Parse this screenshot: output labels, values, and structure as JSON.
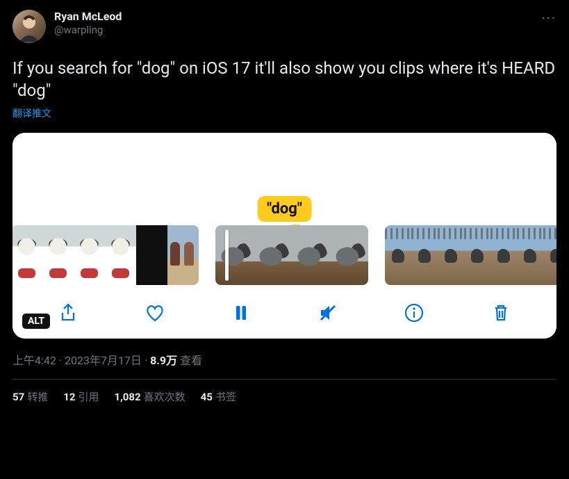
{
  "author": {
    "display_name": "Ryan McLeod",
    "handle": "@warpling"
  },
  "tweet_text": "If you search for \"dog\" on iOS 17 it'll also show you clips where it's HEARD \"dog\"",
  "translate_label": "翻译推文",
  "image": {
    "search_bubble": "\"dog\"",
    "alt_badge": "ALT",
    "controls": {
      "share": "share-icon",
      "like": "heart-icon",
      "pause": "pause-icon",
      "mute": "mute-icon",
      "info": "info-icon",
      "trash": "trash-icon"
    }
  },
  "meta": {
    "time": "上午4:42",
    "dot": " · ",
    "date": "2023年7月17日",
    "views_count": "8.9万",
    "views_label": " 查看"
  },
  "stats": {
    "retweets_n": "57",
    "retweets_label": "转推",
    "quotes_n": "12",
    "quotes_label": "引用",
    "likes_n": "1,082",
    "likes_label": "喜欢次数",
    "bookmarks_n": "45",
    "bookmarks_label": "书签"
  }
}
